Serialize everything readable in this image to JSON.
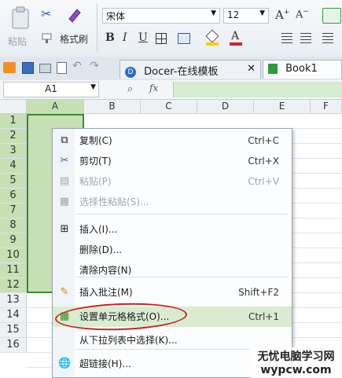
{
  "ribbon": {
    "paste_label": "粘贴",
    "format_painter_label": "格式刷",
    "font_name": "宋体",
    "font_size": "12",
    "bold": "B",
    "italic": "I",
    "underline": "U",
    "font_color_glyph": "A",
    "grow_font": "A⁺",
    "shrink_font": "A⁻"
  },
  "tabs": [
    {
      "label": "Docer-在线模板"
    },
    {
      "label": "Book1"
    }
  ],
  "formula_bar": {
    "name_box": "A1",
    "fx": "fx"
  },
  "columns": [
    "A",
    "B",
    "C",
    "D",
    "E",
    "F"
  ],
  "rows": [
    "1",
    "2",
    "3",
    "4",
    "5",
    "6",
    "7",
    "8",
    "9",
    "10",
    "11",
    "12",
    "13",
    "14",
    "15",
    "16"
  ],
  "context_menu": {
    "items": [
      {
        "label": "复制(C)",
        "shortcut": "Ctrl+C",
        "icon": "copy-icon"
      },
      {
        "label": "剪切(T)",
        "shortcut": "Ctrl+X",
        "icon": "scissors-icon"
      },
      {
        "label": "粘贴(P)",
        "shortcut": "Ctrl+V",
        "icon": "paste-icon",
        "disabled": true
      },
      {
        "label": "选择性粘贴(S)...",
        "shortcut": "",
        "icon": "paste-special-icon",
        "disabled": true
      },
      {
        "label": "插入(I)...",
        "shortcut": "",
        "icon": "insert-icon"
      },
      {
        "label": "删除(D)...",
        "shortcut": "",
        "icon": ""
      },
      {
        "label": "清除内容(N)",
        "shortcut": "",
        "icon": ""
      },
      {
        "label": "插入批注(M)",
        "shortcut": "Shift+F2",
        "icon": "comment-icon"
      },
      {
        "label": "设置单元格格式(O)...",
        "shortcut": "Ctrl+1",
        "icon": "format-cells-icon",
        "highlighted": true
      },
      {
        "label": "从下拉列表中选择(K)...",
        "shortcut": "",
        "icon": ""
      },
      {
        "label": "超链接(H)...",
        "shortcut": "Ct",
        "icon": "hyperlink-icon"
      }
    ]
  },
  "watermark": {
    "line1": "无忧电脑学习网",
    "line2": "wypcw.com"
  },
  "colors": {
    "selection": "#c6e0b4",
    "highlight": "#d9ecd2",
    "circle": "#d32020"
  }
}
